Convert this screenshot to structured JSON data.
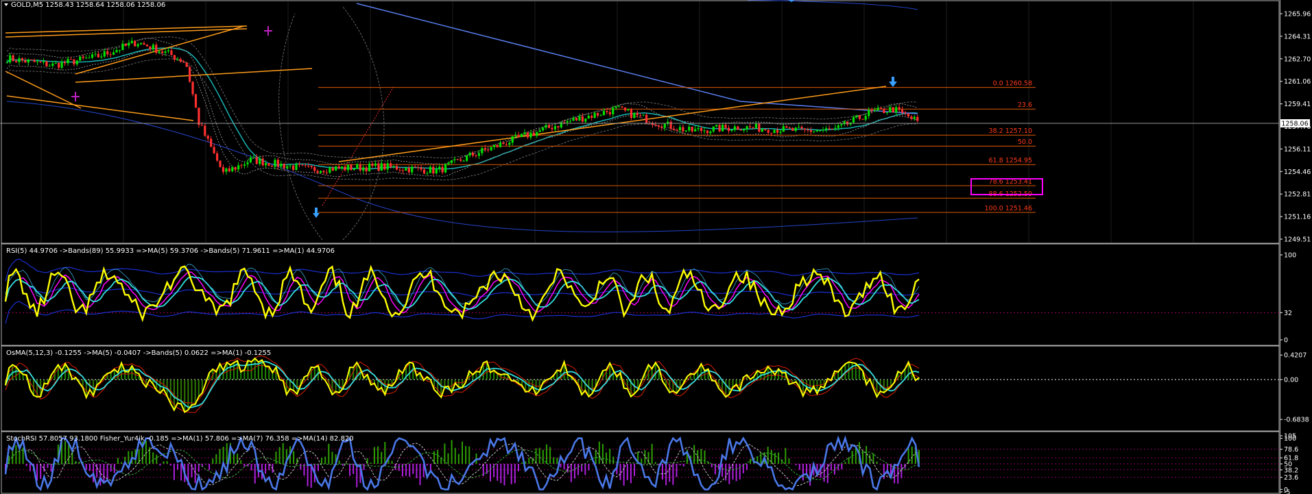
{
  "symbol_header": "GOLD,M5  1258.43 1258.64 1258.06 1258.06",
  "colors": {
    "background": "#000000",
    "grid": "#1e1e1e",
    "panel_border": "#b0b0b0",
    "candle_up": "#00e000",
    "candle_down": "#ff3030",
    "fib_line": "#e05a00",
    "fib_text": "#ff3b1a",
    "trend": "#ff9c1a",
    "ma_blue": "#5a7ef0",
    "ma_teal": "#18b4b4",
    "rsi_line": "#ffff00",
    "magenta": "#ff00ff",
    "cyan": "#33e0e0"
  },
  "price_axis": {
    "labels": [
      "1265.96",
      "1264.31",
      "1262.70",
      "1261.06",
      "1259.41",
      "1257.76",
      "1256.11",
      "1254.46",
      "1252.81",
      "1251.16",
      "1249.51"
    ],
    "current_price": "1258.06"
  },
  "fib_levels": [
    {
      "label": "0.0  1260.58",
      "price": 1260.58
    },
    {
      "label": "23.6",
      "price": 1259.0
    },
    {
      "label": "38.2  1257.10",
      "price": 1257.1
    },
    {
      "label": "50.0",
      "price": 1256.3
    },
    {
      "label": "61.8  1254.95",
      "price": 1254.95
    },
    {
      "label": "78.6  1253.41",
      "price": 1253.41
    },
    {
      "label": "88.6  1252.50",
      "price": 1252.5
    },
    {
      "label": "100.0  1251.46",
      "price": 1251.46
    }
  ],
  "panels": {
    "rsi": {
      "header": "RSI(5) 44.9706  ->Bands(89) 55.9933  =>MA(5) 59.3706  ->Bands(5) 71.9611  =>MA(1) 44.9706",
      "axis_labels": [
        "100",
        "32",
        "0"
      ]
    },
    "osma": {
      "header": "OsMA(5,12,3) -0.1255  ->MA(5) -0.0407  ->Bands(5) 0.0622  =>MA(1) -0.1255",
      "axis_labels": [
        "0.4207",
        "0.00",
        "-0.6838"
      ]
    },
    "stoch": {
      "header": "StochRSI 57.8057 93.1800  Fisher_Yur4ik -0.185  =>MA(1) 57.806  =>MA(7) 76.358  =>MA(14) 82.820",
      "axis_labels": [
        "105",
        "100",
        "78.6",
        "61.8",
        "50",
        "38.2",
        "23.6",
        "0",
        "-5"
      ]
    }
  }
}
